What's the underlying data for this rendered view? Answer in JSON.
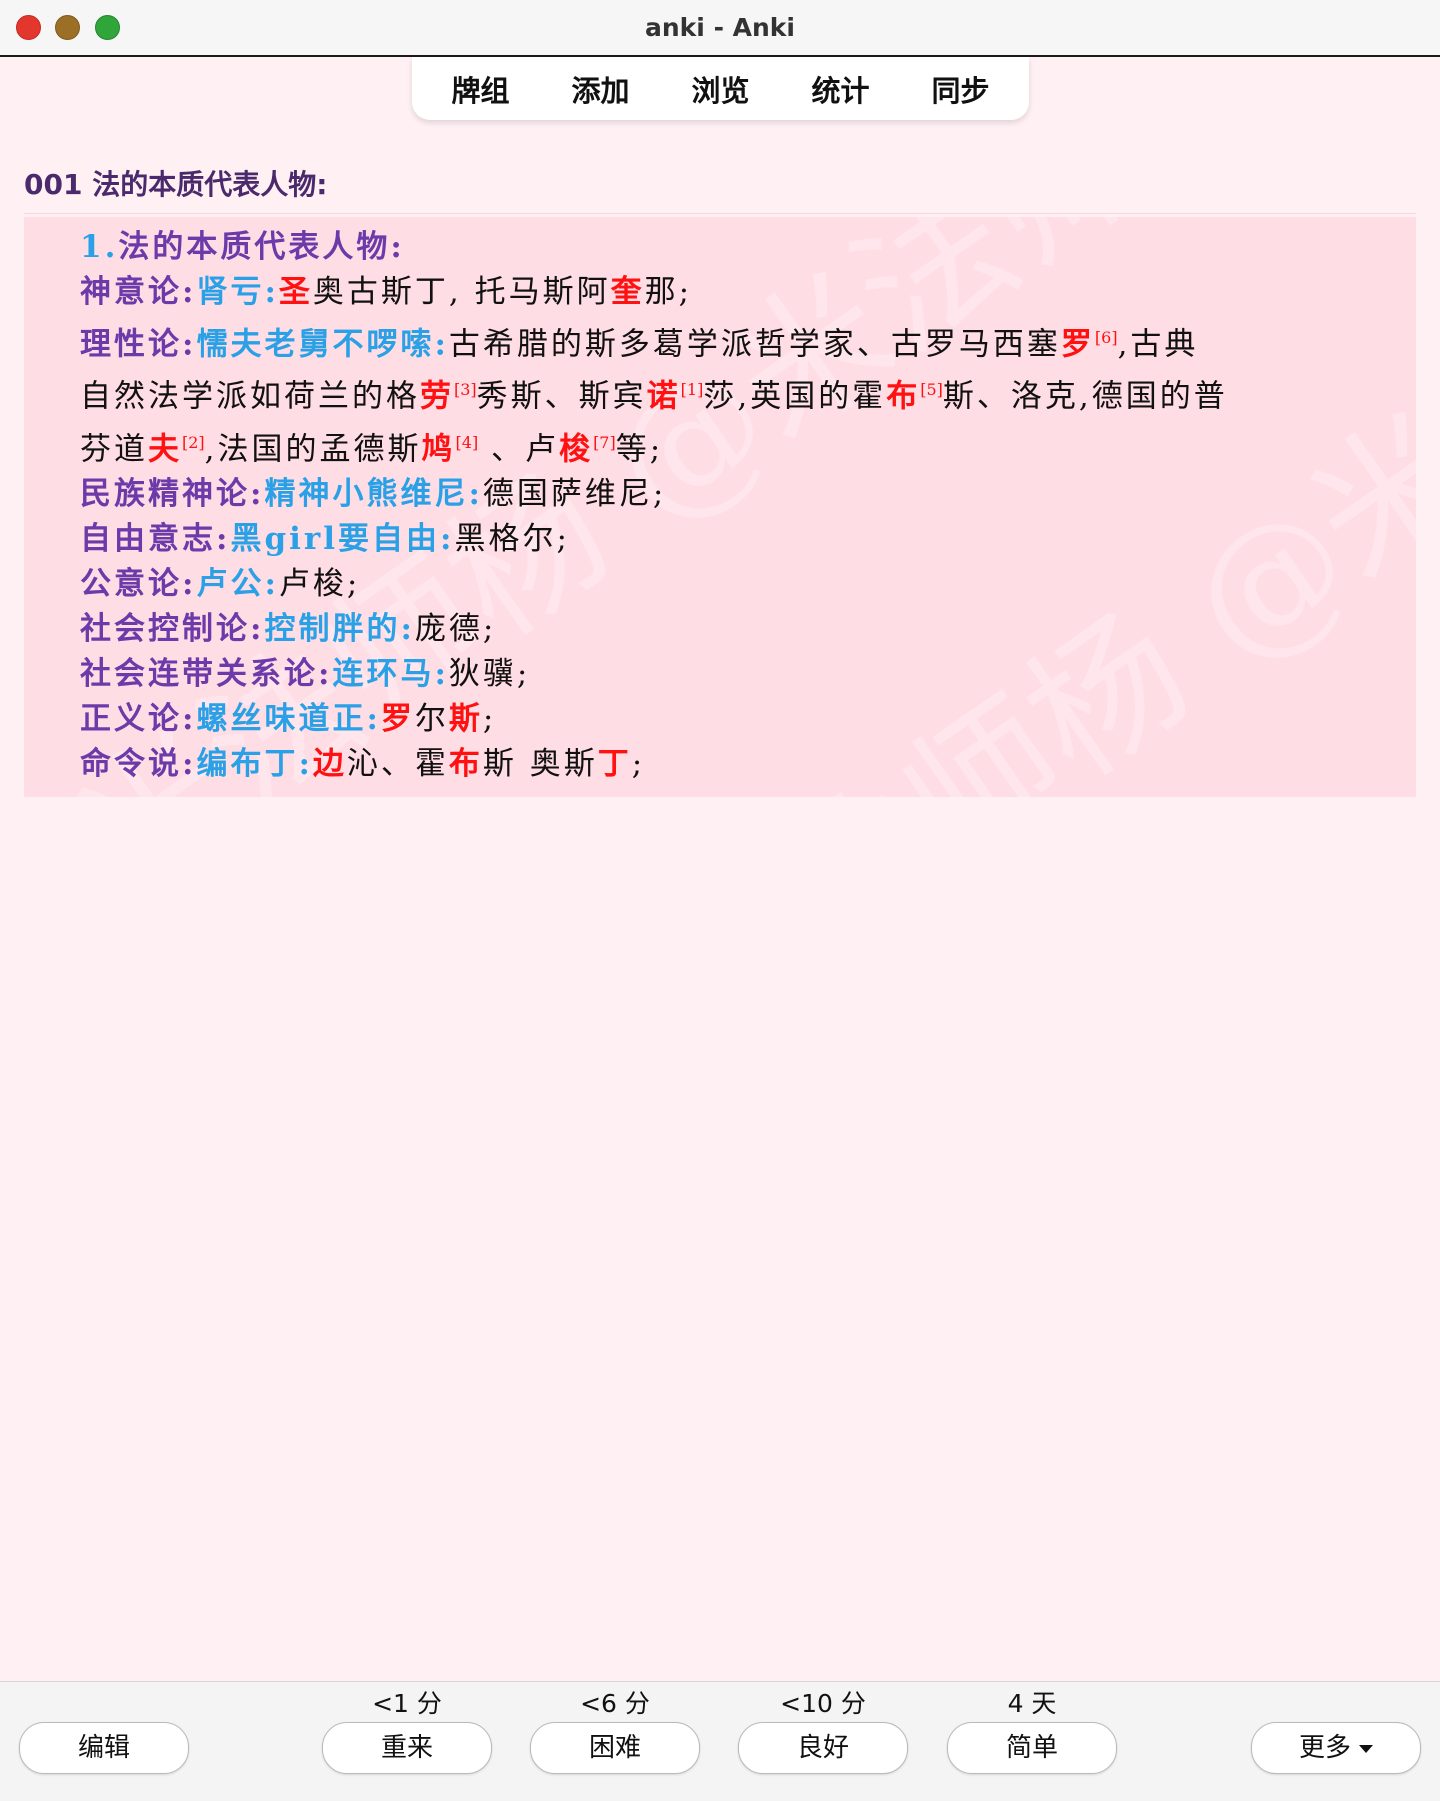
{
  "window": {
    "title": "anki - Anki"
  },
  "toolbar": {
    "items": [
      "牌组",
      "添加",
      "浏览",
      "统计",
      "同步"
    ]
  },
  "card": {
    "question": "001 法的本质代表人物:",
    "watermark": "米法师杨 @米法师杨",
    "heading_num": "1.",
    "heading_text": "法的本质代表人物:",
    "lines": {
      "l1": {
        "cat": "神意论:",
        "mn": "肾亏:",
        "r1": "圣",
        "t1": "奥古斯丁, 托马斯阿",
        "r2": "奎",
        "t2": "那;"
      },
      "l2": {
        "cat": "理性论:",
        "mn": "懦夫老舅不啰嗦:",
        "t1": "古希腊的斯多葛学派哲学家、古罗马西塞",
        "r1": "罗",
        "ref1": "[6]",
        "t2": ",古典"
      },
      "l3": {
        "t1": "自然法学派如荷兰的格",
        "r1": "劳",
        "ref1": "[3]",
        "t2": "秀斯、斯宾",
        "r2": "诺",
        "ref2": "[1]",
        "t3": "莎,英国的霍",
        "r3": "布",
        "ref3": "[5]",
        "t4": "斯、洛克,德国的普"
      },
      "l4": {
        "t1": "芬道",
        "r1": "夫",
        "ref1": "[2]",
        "t2": ",法国的孟德斯",
        "r2": "鸠",
        "ref2": "[4]",
        "t3": " 、卢",
        "r3": "梭",
        "ref3": "[7]",
        "t4": "等;"
      },
      "l5": {
        "cat": "民族精神论:",
        "mn": "精神小熊维尼:",
        "t1": "德国萨维尼;"
      },
      "l6": {
        "cat": "自由意志:",
        "mn": "黑girl要自由:",
        "t1": "黑格尔;"
      },
      "l7": {
        "cat": "公意论:",
        "mn": "卢公:",
        "t1": "卢梭;"
      },
      "l8": {
        "cat": "社会控制论:",
        "mn": "控制胖的:",
        "t1": "庞德;"
      },
      "l9": {
        "cat": "社会连带关系论:",
        "mn": "连环马:",
        "t1": "狄骥;"
      },
      "l10": {
        "cat": "正义论:",
        "mn": "螺丝味道正:",
        "r1": "罗",
        "t1": "尔",
        "r2": "斯",
        "t2": ";"
      },
      "l11": {
        "cat": "命令说:",
        "mn": "编布丁:",
        "r1": "边",
        "t1": "沁、霍",
        "r2": "布",
        "t2": "斯 奥斯",
        "r3": "丁",
        "t3": ";"
      }
    }
  },
  "bottom": {
    "edit_label": "编辑",
    "more_label": "更多",
    "answers": [
      {
        "interval": "<1 分",
        "label": "重来"
      },
      {
        "interval": "<6 分",
        "label": "困难"
      },
      {
        "interval": "<10 分",
        "label": "良好"
      },
      {
        "interval": "4 天",
        "label": "简单"
      }
    ]
  }
}
